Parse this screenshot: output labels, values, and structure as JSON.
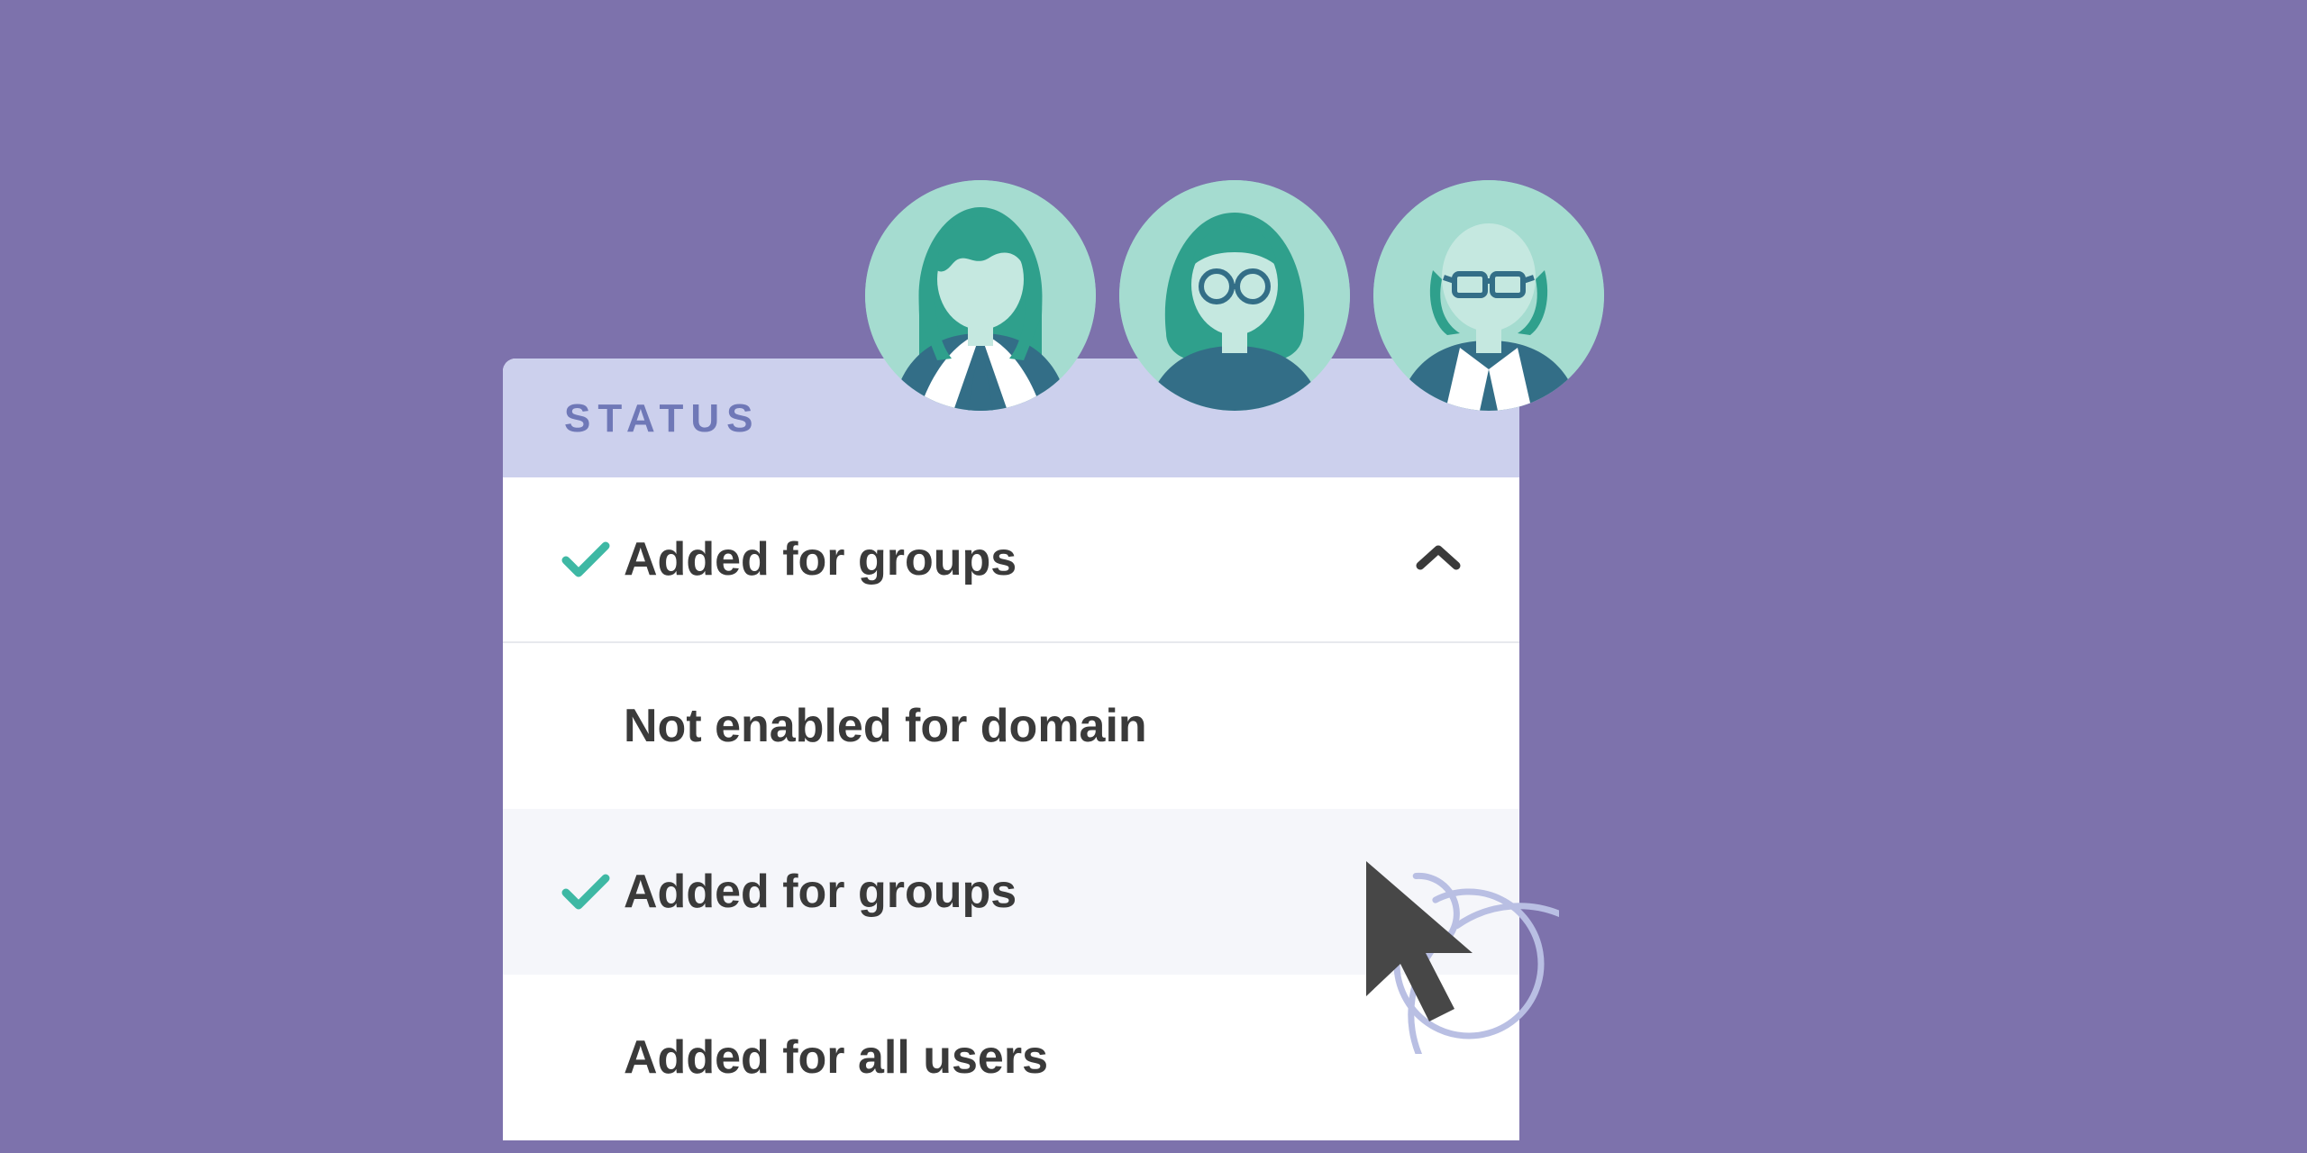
{
  "panel": {
    "header": "STATUS",
    "selected": {
      "label": "Added for groups",
      "checked": true
    },
    "options": [
      {
        "label": "Not enabled for domain",
        "checked": false
      },
      {
        "label": "Added for groups",
        "checked": true
      },
      {
        "label": "Added for all users",
        "checked": false
      }
    ]
  },
  "colors": {
    "background": "#7d72ac",
    "headerBg": "#ccd0ed",
    "headerText": "#6f78b7",
    "checkmark": "#3eb8a4",
    "text": "#3a3a3a",
    "hoverRow": "#f5f6fa",
    "avatarBg": "#a5dcd0",
    "avatarDark": "#336e87",
    "avatarSkin": "#c5e8e0"
  }
}
